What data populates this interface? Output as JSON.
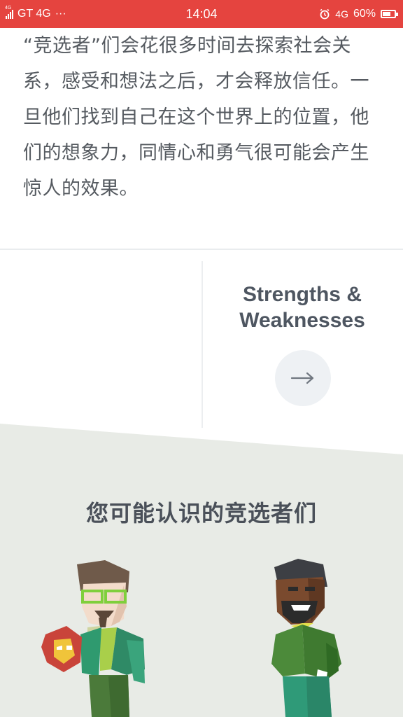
{
  "status_bar": {
    "network_left": "GT 4G",
    "signal_small_label": "4G",
    "more": "···",
    "time": "14:04",
    "network_right": "4G",
    "battery": "60%"
  },
  "content": {
    "paragraph": "“竞选者”们会花很多时间去探索社会关系，感受和想法之后，才会释放信任。一旦他们找到自己在这个世界上的位置，他们的想象力，同情心和勇气很可能会产生惊人的效果。"
  },
  "nav_card": {
    "title_line1": "Strengths &",
    "title_line2": "Weaknesses",
    "arrow_icon": "arrow-right-icon"
  },
  "famous_section": {
    "title": "您可能认识的竞选者们",
    "characters": [
      "character-figure-1",
      "character-figure-2"
    ]
  },
  "colors": {
    "status_bar": "#e5443f",
    "text": "#555a60",
    "section_bg": "#e8ebe6",
    "arrow_button_bg": "#eef1f4"
  }
}
